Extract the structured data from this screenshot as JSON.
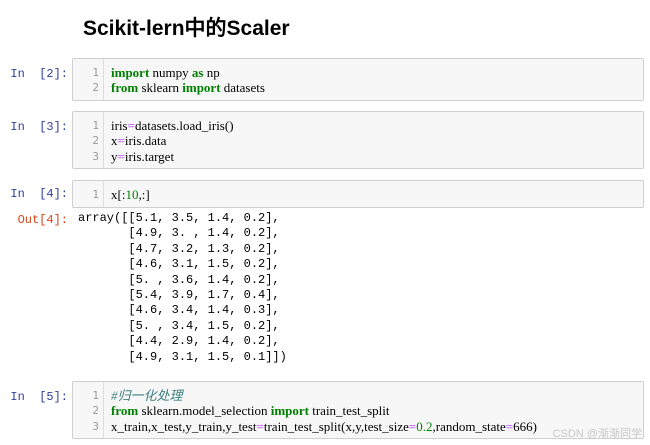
{
  "title": "Scikit-lern中的Scaler",
  "cells": [
    {
      "prompt": "In  [2]:",
      "line_numbers": [
        "1",
        "2"
      ],
      "lines": [
        [
          {
            "t": "import",
            "c": "kw"
          },
          {
            "t": " numpy ",
            "c": ""
          },
          {
            "t": "as",
            "c": "kw"
          },
          {
            "t": " np",
            "c": ""
          }
        ],
        [
          {
            "t": "from",
            "c": "kw"
          },
          {
            "t": " sklearn ",
            "c": ""
          },
          {
            "t": "import",
            "c": "kw"
          },
          {
            "t": " datasets",
            "c": ""
          }
        ]
      ]
    },
    {
      "prompt": "In  [3]:",
      "line_numbers": [
        "1",
        "2",
        "3"
      ],
      "lines": [
        [
          {
            "t": "iris",
            "c": ""
          },
          {
            "t": "=",
            "c": "op"
          },
          {
            "t": "datasets.load_iris()",
            "c": ""
          }
        ],
        [
          {
            "t": "x",
            "c": ""
          },
          {
            "t": "=",
            "c": "op"
          },
          {
            "t": "iris.data",
            "c": ""
          }
        ],
        [
          {
            "t": "y",
            "c": ""
          },
          {
            "t": "=",
            "c": "op"
          },
          {
            "t": "iris.target",
            "c": ""
          }
        ]
      ]
    },
    {
      "prompt": "In  [4]:",
      "line_numbers": [
        "1"
      ],
      "lines": [
        [
          {
            "t": "x[:",
            "c": ""
          },
          {
            "t": "10",
            "c": "num"
          },
          {
            "t": ",:]",
            "c": ""
          }
        ]
      ]
    },
    {
      "prompt": "In  [5]:",
      "line_numbers": [
        "1",
        "2",
        "3"
      ],
      "lines": [
        [
          {
            "t": "#归一化处理",
            "c": "cm"
          }
        ],
        [
          {
            "t": "from",
            "c": "kw"
          },
          {
            "t": " sklearn.model_selection ",
            "c": ""
          },
          {
            "t": "import",
            "c": "kw"
          },
          {
            "t": " train_test_split",
            "c": ""
          }
        ],
        [
          {
            "t": "x_train,x_test,y_train,y_test",
            "c": ""
          },
          {
            "t": "=",
            "c": "op"
          },
          {
            "t": "train_test_split(x,y,test_size",
            "c": ""
          },
          {
            "t": "=",
            "c": "op"
          },
          {
            "t": "0.2",
            "c": "num"
          },
          {
            "t": ",random_state",
            "c": ""
          },
          {
            "t": "=",
            "c": "op"
          },
          {
            "t": "666)",
            "c": ""
          }
        ]
      ]
    }
  ],
  "output": {
    "prompt": "Out[4]:",
    "lines": [
      "array([[5.1, 3.5, 1.4, 0.2],",
      "       [4.9, 3. , 1.4, 0.2],",
      "       [4.7, 3.2, 1.3, 0.2],",
      "       [4.6, 3.1, 1.5, 0.2],",
      "       [5. , 3.6, 1.4, 0.2],",
      "       [5.4, 3.9, 1.7, 0.4],",
      "       [4.6, 3.4, 1.4, 0.3],",
      "       [5. , 3.4, 1.5, 0.2],",
      "       [4.4, 2.9, 1.4, 0.2],",
      "       [4.9, 3.1, 1.5, 0.1]])"
    ]
  },
  "watermark": "CSDN @渐渐同学"
}
